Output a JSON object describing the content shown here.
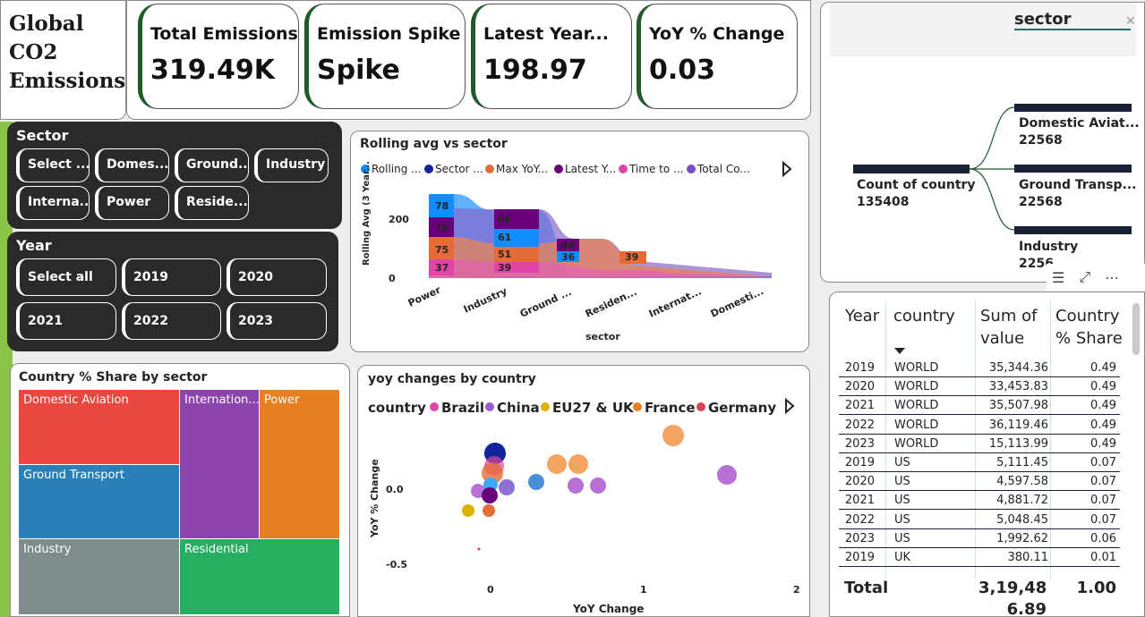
{
  "title": {
    "line1": "Global",
    "line2": "CO2",
    "line3": "Emissions"
  },
  "kpis": [
    {
      "label": "Total Emissions",
      "value": "319.49K"
    },
    {
      "label": "Emission Spike",
      "value": "Spike"
    },
    {
      "label": "Latest Year...",
      "value": "198.97"
    },
    {
      "label": "YoY % Change",
      "value": "0.03"
    }
  ],
  "sector_slicer": {
    "header": "Sector",
    "items": [
      "Select ...",
      "Domes...",
      "Ground...",
      "Industry",
      "Interna...",
      "Power",
      "Reside..."
    ]
  },
  "year_slicer": {
    "header": "Year",
    "items": [
      "Select all",
      "2019",
      "2020",
      "2021",
      "2022",
      "2023"
    ]
  },
  "ribbon_chart": {
    "title": "Rolling avg vs sector",
    "legend": [
      "Rolling ...",
      "Sector ...",
      "Max YoY...",
      "Latest Y...",
      "Time to ...",
      "Total Co..."
    ],
    "legend_colors": [
      "#118dff",
      "#12239e",
      "#e66c37",
      "#6b007b",
      "#e044a7",
      "#744ec2"
    ],
    "ylabel": "Rolling Avg (3 Year...",
    "xlabel": "sector",
    "yticks": [
      "200",
      "0"
    ],
    "categories": [
      "Power",
      "Industry",
      "Ground ...",
      "Residen...",
      "Internat...",
      "Domesti..."
    ],
    "data_labels": [
      "78",
      "76",
      "75",
      "37",
      "66",
      "61",
      "51",
      "39",
      "40",
      "36",
      "39"
    ]
  },
  "treemap": {
    "title": "Country % Share by sector",
    "tiles": [
      {
        "label": "Domestic Aviation",
        "color": "#e8483f"
      },
      {
        "label": "Internation...",
        "color": "#8e44ad"
      },
      {
        "label": "Power",
        "color": "#e67e22"
      },
      {
        "label": "Ground Transport",
        "color": "#2980b9"
      },
      {
        "label": "Industry",
        "color": "#7f8c8d"
      },
      {
        "label": "Residential",
        "color": "#27ae60"
      }
    ]
  },
  "scatter": {
    "title": "yoy changes by country",
    "legend_title": "country",
    "legend": [
      {
        "name": "Brazil",
        "color": "#e044a7"
      },
      {
        "name": "China",
        "color": "#9b59d0"
      },
      {
        "name": "EU27 & UK",
        "color": "#d9b300"
      },
      {
        "name": "France",
        "color": "#e67e22"
      },
      {
        "name": "Germany",
        "color": "#d64550"
      }
    ],
    "ylabel": "YoY % Change",
    "xlabel": "YoY Change",
    "yticks": [
      "0.0",
      "-0.5"
    ],
    "xticks": [
      "0",
      "1",
      "2"
    ]
  },
  "decomp": {
    "title": "sector",
    "root_label": "Count of country",
    "root_value": "135408",
    "nodes": [
      {
        "label": "Domestic Aviat...",
        "value": "22568"
      },
      {
        "label": "Ground Transp...",
        "value": "22568"
      },
      {
        "label": "Industry",
        "value": "2256"
      }
    ]
  },
  "table": {
    "headers": [
      "Year",
      "country",
      "Sum of value",
      "Country % Share"
    ],
    "rows": [
      [
        "2019",
        "WORLD",
        "35,344.36",
        "0.49"
      ],
      [
        "2020",
        "WORLD",
        "33,453.83",
        "0.49"
      ],
      [
        "2021",
        "WORLD",
        "35,507.98",
        "0.49"
      ],
      [
        "2022",
        "WORLD",
        "36,119.46",
        "0.49"
      ],
      [
        "2023",
        "WORLD",
        "15,113.99",
        "0.49"
      ],
      [
        "2019",
        "US",
        "5,111.45",
        "0.07"
      ],
      [
        "2020",
        "US",
        "4,597.58",
        "0.07"
      ],
      [
        "2021",
        "US",
        "4,881.72",
        "0.07"
      ],
      [
        "2022",
        "US",
        "5,048.45",
        "0.07"
      ],
      [
        "2023",
        "US",
        "1,992.62",
        "0.06"
      ],
      [
        "2019",
        "UK",
        "380.11",
        "0.01"
      ]
    ],
    "total_label": "Total",
    "total_value_line1": "3,19,48",
    "total_value_line2": "6.89",
    "total_share": "1.00"
  }
}
